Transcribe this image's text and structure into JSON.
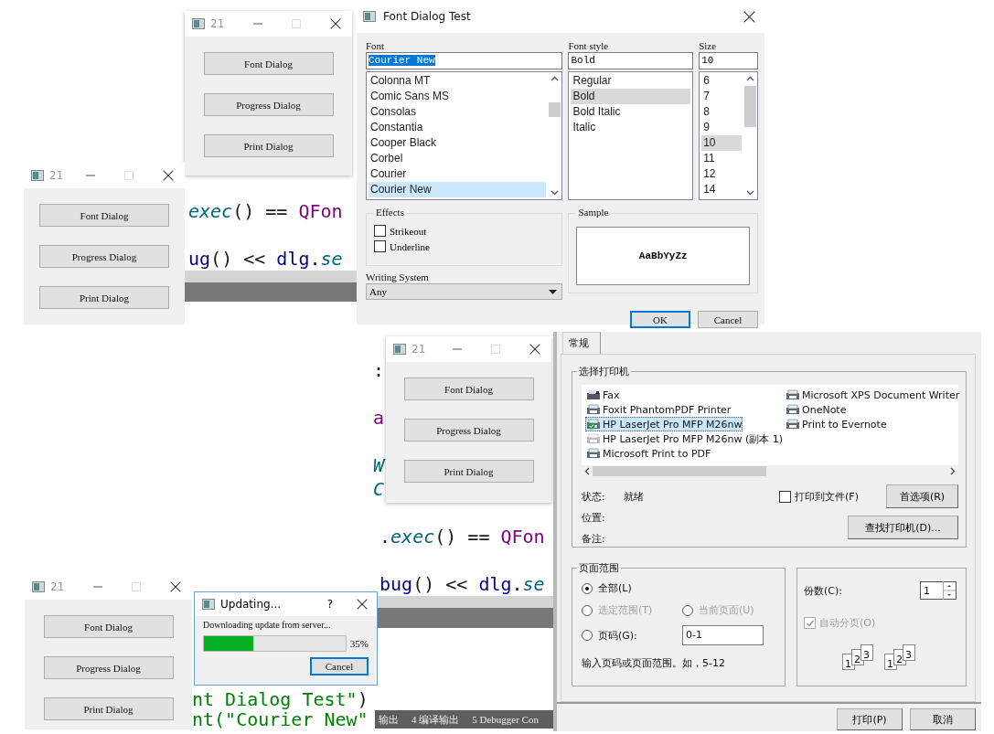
{
  "small_windows": [
    {
      "title": "21",
      "buttons": [
        "Font Dialog",
        "Progress Dialog",
        "Print Dialog"
      ]
    },
    {
      "title": "21",
      "buttons": [
        "Font Dialog",
        "Progress Dialog",
        "Print Dialog"
      ]
    },
    {
      "title": "21",
      "buttons": [
        "Font Dialog",
        "Progress Dialog",
        "Print Dialog"
      ]
    },
    {
      "title": "21",
      "buttons": [
        "Font Dialog",
        "Progress Dialog",
        "Print Dialog"
      ]
    }
  ],
  "code_views": [
    {
      "lines": [
        [
          {
            "text": "exec",
            "color": "#00677c"
          },
          {
            "text": "() == ",
            "color": "#1a1a1a"
          },
          {
            "text": "QFon",
            "color": "#800080"
          }
        ],
        [
          {
            "text": "ug",
            "color": "#000080"
          },
          {
            "text": "() << ",
            "color": "#1a1a1a"
          },
          {
            "text": "dlg.",
            "color": "#000080"
          },
          {
            "text": "se",
            "color": "#00677c"
          }
        ]
      ]
    },
    {
      "lines": [
        [
          {
            "text": "nt Dialog Test\"",
            "color": "#008000"
          },
          {
            "text": ")",
            "color": "#1a1a1a"
          }
        ],
        [
          {
            "text": "nt(\"Courier New\"",
            "color": "#008000"
          }
        ]
      ]
    },
    {
      "lines": [
        [
          {
            "text": ":",
            "color": "#1a1a1a"
          }
        ],
        [
          {
            "text": "a",
            "color": "#800080"
          }
        ],
        [
          {
            "text": "W",
            "color": "#00677c"
          }
        ],
        [
          {
            "text": "C",
            "color": "#00677c"
          }
        ],
        [
          {
            "text": ".",
            "color": "#1a1a1a"
          },
          {
            "text": "exec",
            "color": "#00677c"
          },
          {
            "text": "() == ",
            "color": "#1a1a1a"
          },
          {
            "text": "QFon",
            "color": "#800080"
          }
        ],
        [
          {
            "text": "bug",
            "color": "#000080"
          },
          {
            "text": "() << ",
            "color": "#1a1a1a"
          },
          {
            "text": "dlg.",
            "color": "#000080"
          },
          {
            "text": "se",
            "color": "#00677c"
          }
        ]
      ],
      "output_tabs": [
        "输出",
        "4 编译输出",
        "5 Debugger Con"
      ]
    }
  ],
  "font_dialog": {
    "title": "Font Dialog Test",
    "font": {
      "label": "Font",
      "value": "Courier New",
      "items": [
        {
          "label": "Colonna MT",
          "selected": false
        },
        {
          "label": "Comic Sans MS",
          "selected": false
        },
        {
          "label": "Consolas",
          "selected": false
        },
        {
          "label": "Constantia",
          "selected": false
        },
        {
          "label": "Cooper Black",
          "selected": false
        },
        {
          "label": "Corbel",
          "selected": false
        },
        {
          "label": "Courier",
          "selected": false
        },
        {
          "label": "Courier New",
          "selected": true
        }
      ]
    },
    "style": {
      "label": "Font style",
      "value": "Bold",
      "items": [
        {
          "label": "Regular",
          "selected": false
        },
        {
          "label": "Bold",
          "selected": true
        },
        {
          "label": "Bold Italic",
          "selected": false
        },
        {
          "label": "Italic",
          "selected": false
        }
      ]
    },
    "size": {
      "label": "Size",
      "value": "10",
      "items": [
        {
          "label": "6",
          "selected": false
        },
        {
          "label": "7",
          "selected": false
        },
        {
          "label": "8",
          "selected": false
        },
        {
          "label": "9",
          "selected": false
        },
        {
          "label": "10",
          "selected": true
        },
        {
          "label": "11",
          "selected": false
        },
        {
          "label": "12",
          "selected": false
        },
        {
          "label": "14",
          "selected": false
        }
      ]
    },
    "effects": {
      "title": "Effects",
      "options": [
        {
          "label": "Strikeout",
          "checked": false
        },
        {
          "label": "Underline",
          "checked": false
        }
      ]
    },
    "writing_system": {
      "label": "Writing System",
      "value": "Any"
    },
    "sample": {
      "title": "Sample",
      "text": "AaBbYyZz"
    },
    "buttons": [
      "OK",
      "Cancel"
    ]
  },
  "print_dialog": {
    "tabs": [
      {
        "label": "常规",
        "selected": true
      }
    ],
    "printer_group": {
      "title": "选择打印机",
      "printers": [
        {
          "name": "Fax",
          "kind": "fax",
          "selected": false,
          "default": false,
          "offline": false
        },
        {
          "name": "Foxit PhantomPDF Printer",
          "kind": "printer",
          "selected": false,
          "default": false,
          "offline": false
        },
        {
          "name": "HP LaserJet Pro MFP M26nw",
          "kind": "printer",
          "selected": true,
          "default": true,
          "offline": false
        },
        {
          "name": "HP LaserJet Pro MFP M26nw (副本 1)",
          "kind": "printer",
          "selected": false,
          "default": false,
          "offline": true
        },
        {
          "name": "Microsoft Print to PDF",
          "kind": "printer",
          "selected": false,
          "default": false,
          "offline": false
        },
        {
          "name": "Microsoft XPS Document Writer",
          "kind": "printer",
          "selected": false,
          "default": false,
          "offline": false
        },
        {
          "name": "OneNote",
          "kind": "printer",
          "selected": false,
          "default": false,
          "offline": false
        },
        {
          "name": "Print to Evernote",
          "kind": "printer",
          "selected": false,
          "default": false,
          "offline": false
        }
      ],
      "status": [
        {
          "label": "状态:",
          "value": "就绪"
        },
        {
          "label": "位置:"
        },
        {
          "label": "备注:"
        }
      ],
      "print_to_file": {
        "label": "打印到文件(F)",
        "checked": false
      },
      "preferences_button": "首选项(R)",
      "find_printer_button": "查找打印机(D)..."
    },
    "page_range": {
      "title": "页面范围",
      "options": [
        {
          "label": "全部(L)",
          "selected": true,
          "disabled": false
        },
        {
          "label": "选定范围(T)",
          "selected": false,
          "disabled": true
        },
        {
          "label": "当前页面(U)",
          "selected": false,
          "disabled": true
        },
        {
          "label": "页码(G):",
          "selected": false,
          "disabled": false
        }
      ],
      "pages_value": "0-1",
      "hint": "输入页码或页面范围。如，5-12"
    },
    "copies": {
      "label": "份数(C):",
      "value": "1",
      "collate": {
        "label": "自动分页(O)",
        "checked": true,
        "disabled": true
      },
      "stacks": [
        [
          "1",
          "2",
          "3"
        ],
        [
          "1",
          "2",
          "3"
        ]
      ]
    },
    "buttons": [
      "打印(P)",
      "取消"
    ]
  },
  "progress_dialog": {
    "title": "Updating...",
    "help": "?",
    "label": "Downloading update from server...",
    "level": 0.35,
    "percent": "35%",
    "cancel": "Cancel"
  }
}
